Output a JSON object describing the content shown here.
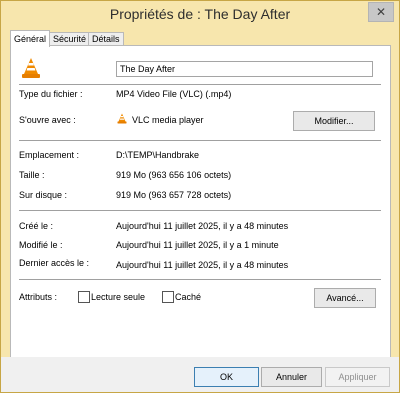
{
  "window": {
    "title": "Propriétés de : The Day After",
    "close_glyph": "✕"
  },
  "tabs": [
    {
      "label": "Général",
      "active": true
    },
    {
      "label": "Sécurité",
      "active": false
    },
    {
      "label": "Détails",
      "active": false
    }
  ],
  "general": {
    "file_name": "The Day After",
    "file_type_label": "Type du fichier :",
    "file_type_value": "MP4 Video File (VLC) (.mp4)",
    "opens_with_label": "S'ouvre avec :",
    "opens_with_value": "VLC media player",
    "change_button": "Modifier...",
    "location_label": "Emplacement :",
    "location_value": "D:\\TEMP\\Handbrake",
    "size_label": "Taille :",
    "size_value": "919 Mo (963 656 106 octets)",
    "disk_size_label": "Sur disque :",
    "disk_size_value": "919 Mo (963 657 728 octets)",
    "created_label": "Créé le :",
    "created_value": "Aujourd'hui 11 juillet 2025, il y a 48 minutes",
    "modified_label": "Modifié le :",
    "modified_value": "Aujourd'hui 11 juillet 2025, il y a 1 minute",
    "accessed_label": "Dernier accès le :",
    "accessed_value": "Aujourd'hui 11 juillet 2025, il y a 48 minutes",
    "attributes_label": "Attributs :",
    "readonly_label": "Lecture seule",
    "hidden_label": "Caché",
    "advanced_button": "Avancé..."
  },
  "footer": {
    "ok": "OK",
    "cancel": "Annuler",
    "apply": "Appliquer"
  },
  "colors": {
    "titlebar": "#f7e6ad",
    "vlc_orange": "#f08a00"
  }
}
